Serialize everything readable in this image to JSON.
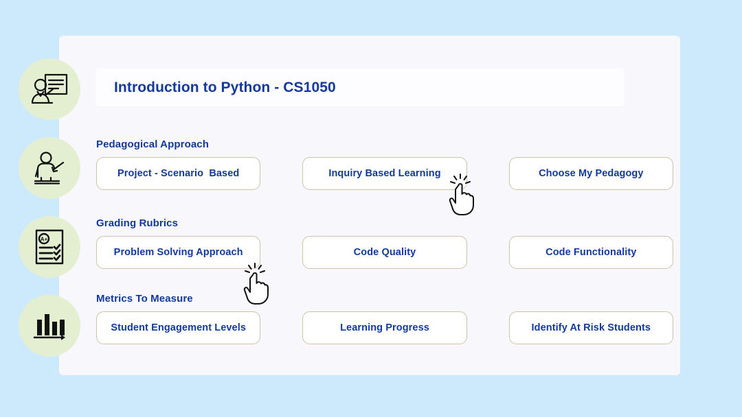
{
  "theme": {
    "page_background": "#cdeafc",
    "card_background": "#f8f7fc",
    "title_bar_background": "#fdfdff",
    "accent_text": "#12399b",
    "button_border": "#cec3a6",
    "button_fill": "#ffffff",
    "icon_circle": "#e4efd2",
    "icon_stroke": "#111111"
  },
  "header": {
    "title": "Introduction to Python - CS1050"
  },
  "sidebar": {
    "items": [
      {
        "icon": "presenter-board-icon",
        "label": "Presenter with board"
      },
      {
        "icon": "lecturer-podium-pointer-icon",
        "label": "Lecturer at podium with pointer"
      },
      {
        "icon": "grading-rubric-checklist-icon",
        "label": "Grading rubric checklist A+"
      },
      {
        "icon": "bar-chart-metrics-icon",
        "label": "Bar chart metrics"
      }
    ]
  },
  "main": {
    "sections": [
      {
        "header": "Pedagogical Approach",
        "buttons": [
          {
            "label": "Project - Scenario  Based"
          },
          {
            "label": "Inquiry Based Learning"
          },
          {
            "label": "Choose My Pedagogy"
          }
        ]
      },
      {
        "header": "Grading Rubrics",
        "buttons": [
          {
            "label": "Problem Solving Approach"
          },
          {
            "label": "Code Quality"
          },
          {
            "label": "Code Functionality"
          }
        ]
      },
      {
        "header": "Metrics To Measure",
        "buttons": [
          {
            "label": "Student Engagement Levels"
          },
          {
            "label": "Learning Progress"
          },
          {
            "label": "Identify At Risk Students"
          }
        ]
      }
    ]
  },
  "cursors": [
    {
      "icon": "pointing-hand-click-cursor",
      "target": "Inquiry Based Learning"
    },
    {
      "icon": "pointing-hand-click-cursor",
      "target": "Problem Solving Approach"
    }
  ]
}
